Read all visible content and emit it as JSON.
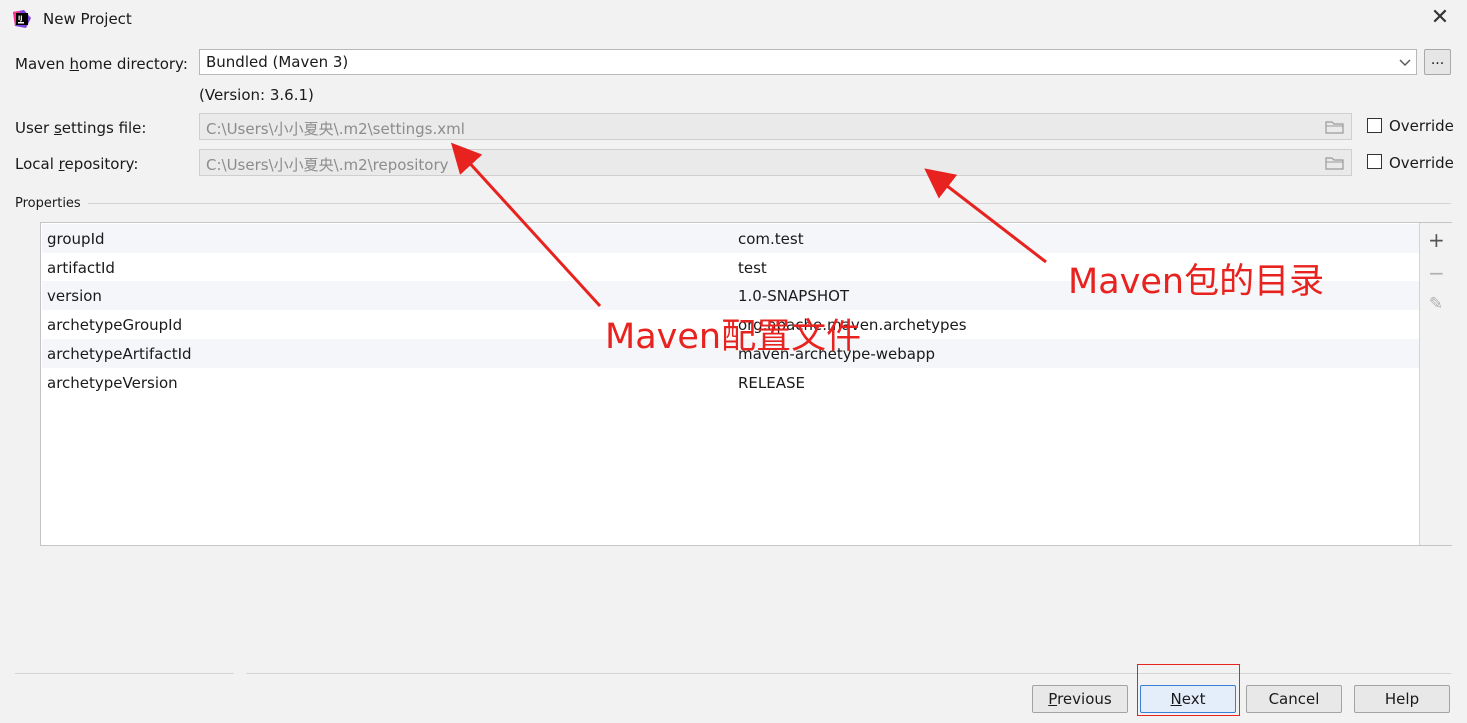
{
  "window": {
    "title": "New Project",
    "close_label": "✕"
  },
  "maven_home": {
    "label": "Maven home directory:",
    "value": "Bundled (Maven 3)",
    "browse_label": "...",
    "version": "(Version: 3.6.1)"
  },
  "user_settings": {
    "label": "User settings file:",
    "value": "C:\\Users\\小小夏央\\.m2\\settings.xml",
    "override_label": "Override",
    "override_checked": false
  },
  "local_repo": {
    "label": "Local repository:",
    "value": "C:\\Users\\小小夏央\\.m2\\repository",
    "override_label": "Override",
    "override_checked": false
  },
  "properties": {
    "label": "Properties",
    "rows": [
      {
        "key": "groupId",
        "value": "com.test"
      },
      {
        "key": "artifactId",
        "value": "test"
      },
      {
        "key": "version",
        "value": "1.0-SNAPSHOT"
      },
      {
        "key": "archetypeGroupId",
        "value": "org.apache.maven.archetypes"
      },
      {
        "key": "archetypeArtifactId",
        "value": "maven-archetype-webapp"
      },
      {
        "key": "archetypeVersion",
        "value": "RELEASE"
      }
    ],
    "tools": {
      "add": "+",
      "remove": "−",
      "edit": "✎"
    }
  },
  "annotations": {
    "config": "Maven配置文件",
    "repo": "Maven包的目录"
  },
  "buttons": {
    "previous": "Previous",
    "next": "Next",
    "cancel": "Cancel",
    "help": "Help"
  },
  "colors": {
    "annotation": "#e8231f",
    "accent": "#3b7ed6"
  }
}
